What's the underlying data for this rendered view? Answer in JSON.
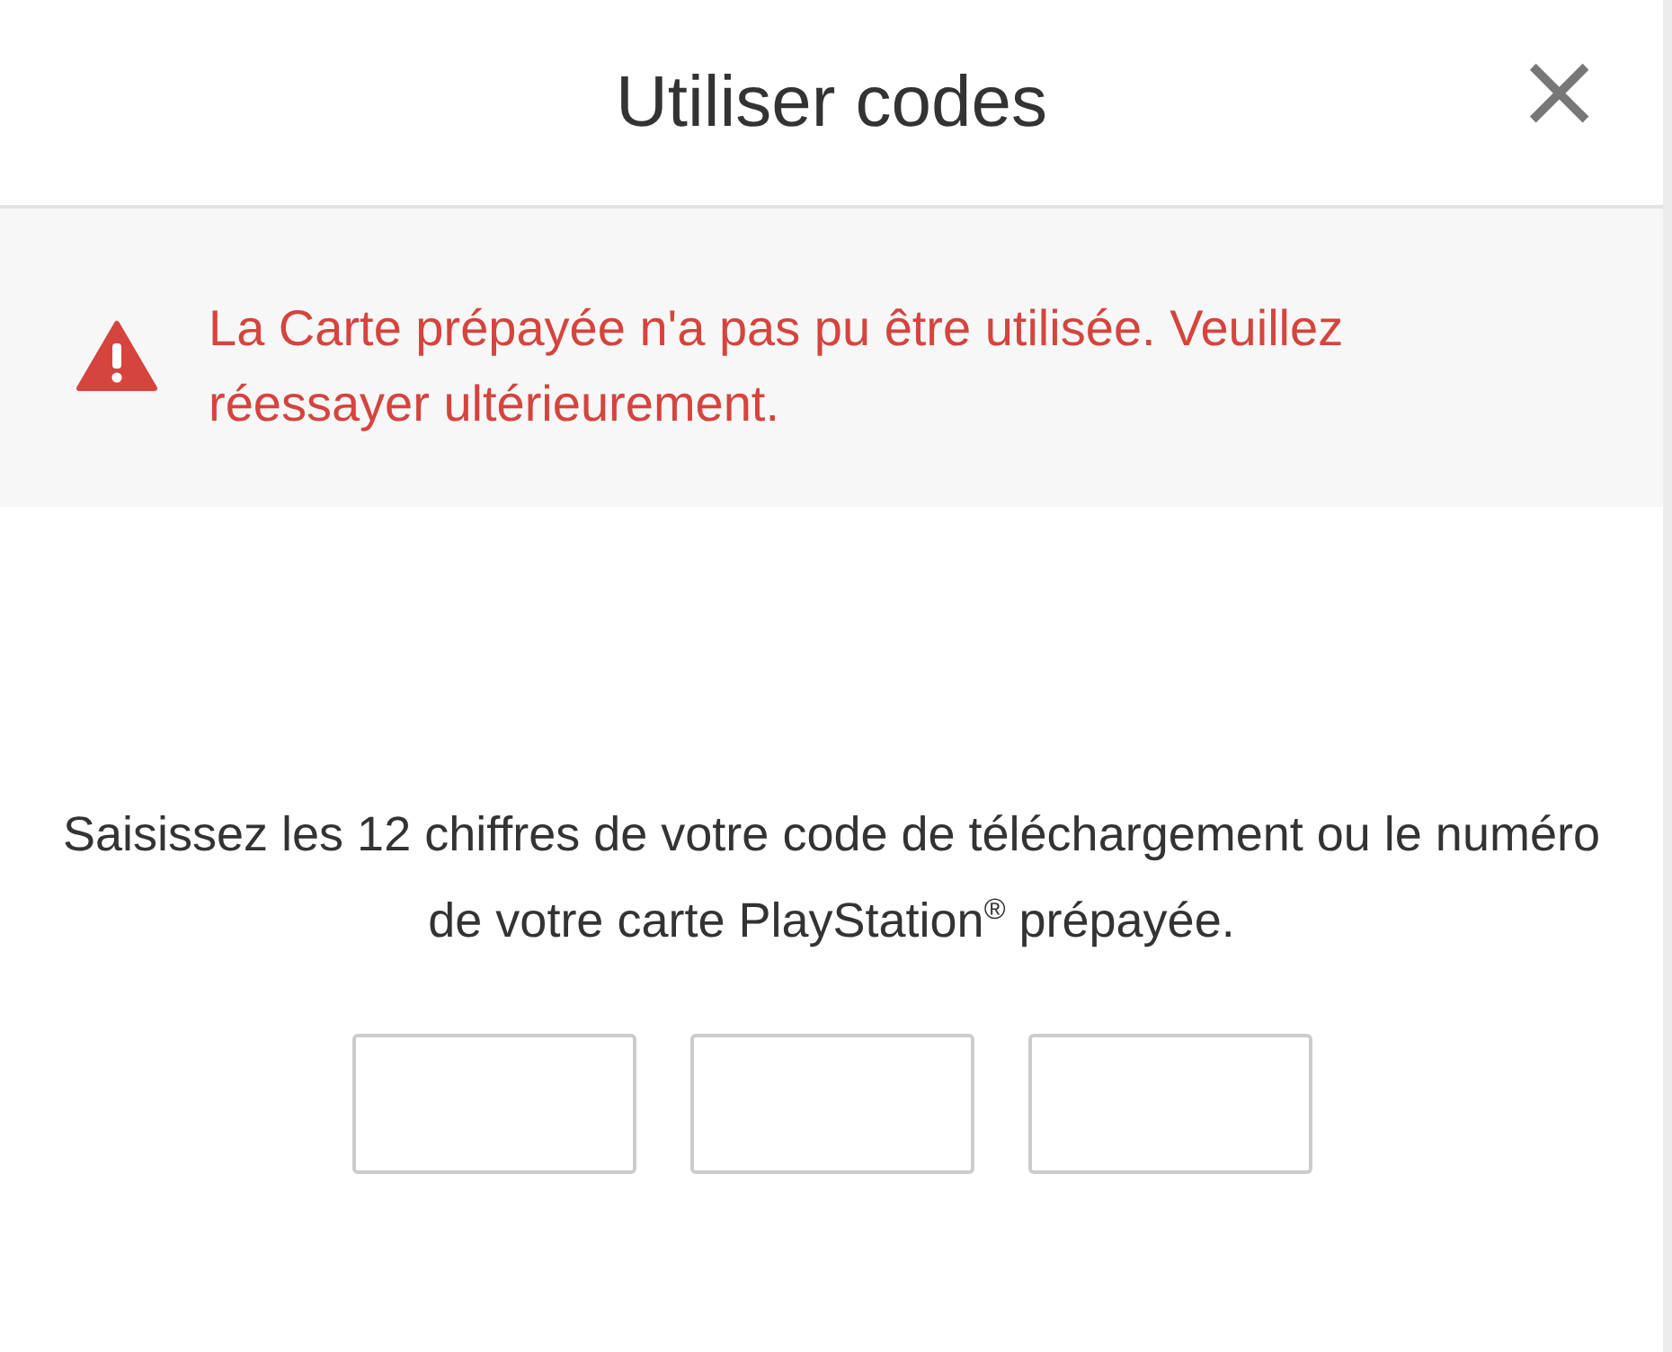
{
  "dialog": {
    "title": "Utiliser codes",
    "close": "×"
  },
  "error": {
    "message": "La Carte prépayée n'a pas pu être utilisée. Veuillez réessayer ultérieurement."
  },
  "instructions": "Saisissez les 12 chiffres de votre code de téléchargement ou le numéro de votre carte PlayStation$^{®}$ prépayée.",
  "code_fields": [
    {
      "kind": "text"
    },
    {
      "kind": "text"
    },
    {
      "kind": "text"
    }
  ]
}
